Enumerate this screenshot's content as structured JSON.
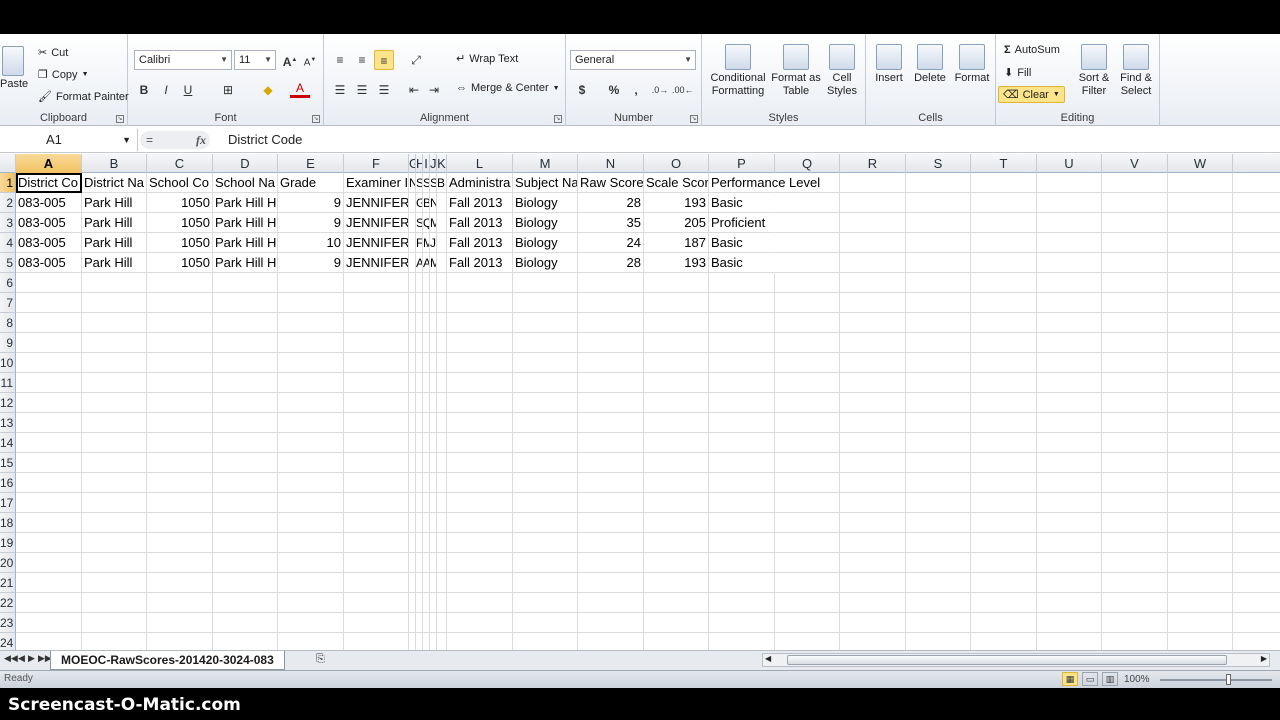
{
  "ribbon": {
    "clipboard": {
      "label": "Clipboard",
      "paste": "Paste",
      "cut": "Cut",
      "copy": "Copy",
      "format_painter": "Format Painter"
    },
    "font": {
      "label": "Font",
      "name": "Calibri",
      "size": "11",
      "bold": "B",
      "italic": "I",
      "underline": "U"
    },
    "alignment": {
      "label": "Alignment",
      "wrap_text": "Wrap Text",
      "merge_center": "Merge & Center"
    },
    "number": {
      "label": "Number",
      "format": "General",
      "currency": "$",
      "percent": "%",
      "comma": ","
    },
    "styles": {
      "label": "Styles",
      "conditional_formatting": "Conditional\nFormatting",
      "format_as_table": "Format as\nTable",
      "cell_styles": "Cell\nStyles"
    },
    "cells": {
      "label": "Cells",
      "insert": "Insert",
      "delete": "Delete",
      "format": "Format"
    },
    "editing": {
      "label": "Editing",
      "autosum": "AutoSum",
      "fill": "Fill",
      "clear": "Clear",
      "sort_filter": "Sort &\nFilter",
      "find_select": "Find &\nSelect"
    }
  },
  "formula_bar": {
    "name_box": "A1",
    "content": "District Code"
  },
  "columns": [
    {
      "label": "A",
      "w": 66
    },
    {
      "label": "B",
      "w": 65
    },
    {
      "label": "C",
      "w": 66
    },
    {
      "label": "D",
      "w": 65
    },
    {
      "label": "E",
      "w": 66
    },
    {
      "label": "F",
      "w": 65
    },
    {
      "label": "G",
      "w": 7
    },
    {
      "label": "H",
      "w": 7
    },
    {
      "label": "I",
      "w": 7
    },
    {
      "label": "J",
      "w": 7
    },
    {
      "label": "K",
      "w": 10
    },
    {
      "label": "L",
      "w": 66
    },
    {
      "label": "M",
      "w": 65
    },
    {
      "label": "N",
      "w": 66
    },
    {
      "label": "O",
      "w": 65
    },
    {
      "label": "P",
      "w": 66
    },
    {
      "label": "Q",
      "w": 65
    },
    {
      "label": "R",
      "w": 66
    },
    {
      "label": "S",
      "w": 65
    },
    {
      "label": "T",
      "w": 66
    },
    {
      "label": "U",
      "w": 65
    },
    {
      "label": "V",
      "w": 66
    },
    {
      "label": "W",
      "w": 65
    }
  ],
  "row_numbers": [
    "1",
    "2",
    "3",
    "4",
    "5",
    "6",
    "7",
    "8",
    "9",
    "10",
    "11",
    "12",
    "13",
    "14",
    "15",
    "16",
    "17",
    "18",
    "19",
    "20",
    "21",
    "22",
    "23",
    "24"
  ],
  "rows": [
    [
      "District Co",
      "District Na",
      "School Co",
      "School Na",
      "Grade",
      "Examiner I",
      "N",
      "S",
      "S",
      "S",
      "B",
      "Administra",
      "Subject Na",
      "Raw Score",
      "Scale Scor",
      "Performance Level"
    ],
    [
      "083-005",
      "Park Hill",
      "1050",
      "Park Hill Hi",
      "9",
      "JENNIFER",
      "",
      "G",
      "B",
      "N",
      "",
      "Fall 2013",
      "Biology",
      "28",
      "193",
      "Basic"
    ],
    [
      "083-005",
      "Park Hill",
      "1050",
      "Park Hill Hi",
      "9",
      "JENNIFER",
      "",
      "S",
      "Q",
      "M",
      "",
      "Fall 2013",
      "Biology",
      "35",
      "205",
      "Proficient"
    ],
    [
      "083-005",
      "Park Hill",
      "1050",
      "Park Hill Hi",
      "10",
      "JENNIFER",
      "",
      "F",
      "M",
      "J",
      "",
      "Fall 2013",
      "Biology",
      "24",
      "187",
      "Basic"
    ],
    [
      "083-005",
      "Park Hill",
      "1050",
      "Park Hill Hi",
      "9",
      "JENNIFER",
      "",
      "A",
      "A",
      "M",
      "",
      "Fall 2013",
      "Biology",
      "28",
      "193",
      "Basic"
    ]
  ],
  "sheet_tab": "MOEOC-RawScores-201420-3024-083",
  "status": {
    "ready": "Ready",
    "zoom": "100%"
  },
  "watermark": "Screencast-O-Matic.com"
}
